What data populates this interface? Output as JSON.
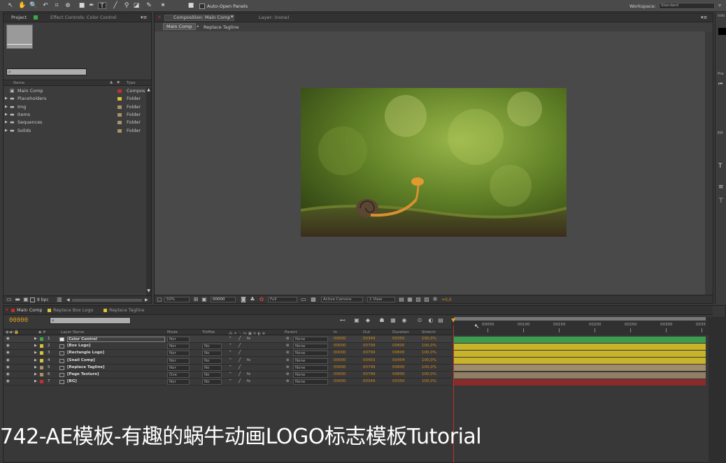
{
  "toolbar": {
    "auto_open_label": "Auto-Open Panels",
    "workspace_label": "Workspace:",
    "workspace_value": "Standard",
    "info_tab": "Info"
  },
  "project_panel": {
    "tabs": [
      {
        "label": "Project"
      },
      {
        "label": "Effect Controls: Color Control"
      }
    ],
    "search_placeholder": "",
    "col_name": "Name",
    "col_type": "Type",
    "items": [
      {
        "name": "Main Comp",
        "type": "Compos",
        "color": "#c03030"
      },
      {
        "name": "Placeholders",
        "type": "Folder",
        "color": "#d9c23a"
      },
      {
        "name": "Img",
        "type": "Folder",
        "color": "#a89268"
      },
      {
        "name": "Items",
        "type": "Folder",
        "color": "#a89268"
      },
      {
        "name": "Sequences",
        "type": "Folder",
        "color": "#a89268"
      },
      {
        "name": "Solids",
        "type": "Folder",
        "color": "#a89268"
      }
    ],
    "bpc": "8 bpc"
  },
  "comp_panel": {
    "tab": "Composition: Main Comp",
    "layer_tab": "Layer: (none)",
    "breadcrumbs": [
      "Main Comp",
      "Replace Tagline"
    ],
    "zoom": "50%",
    "timecode": "00000",
    "resolution": "Full",
    "camera": "Active Camera",
    "view": "1 View",
    "exposure": "+0,0"
  },
  "right_panel": {
    "preview_tab": "Pre",
    "effects_tab": "Eff",
    "paragraph_tab": "Par"
  },
  "timeline": {
    "tabs": [
      {
        "label": "Main Comp",
        "color": "#c03030"
      },
      {
        "label": "Replace Box Logo",
        "color": "#d9c23a"
      },
      {
        "label": "Replace Tagline",
        "color": "#d9c23a"
      }
    ],
    "timecode": "00000",
    "search_placeholder": "",
    "headers": {
      "layer_name": "Layer Name",
      "mode": "Mode",
      "trkmat": "TrkMat",
      "parent": "Parent",
      "in": "In",
      "out": "Out",
      "duration": "Duration",
      "stretch": "Stretch"
    },
    "ruler": [
      "00050",
      "00100",
      "00150",
      "00200",
      "00250",
      "00300",
      "0035"
    ],
    "layers": [
      {
        "num": "1",
        "name": "Color Control",
        "color": "#3fa84a",
        "mode": "Nor",
        "trk": "",
        "parent": "None",
        "in": "00000",
        "out": "00349",
        "dur": "00350",
        "stretch": "100,0%",
        "bar": "#3e9c50",
        "fx": "fx"
      },
      {
        "num": "2",
        "name": "[Box Logo]",
        "color": "#d9c23a",
        "mode": "Nor",
        "trk": "No",
        "parent": "None",
        "in": "00000",
        "out": "00799",
        "dur": "00800",
        "stretch": "100,0%",
        "bar": "#c8b42a",
        "fx": ""
      },
      {
        "num": "3",
        "name": "[Rectangle Logo]",
        "color": "#d9c23a",
        "mode": "Nor",
        "trk": "No",
        "parent": "None",
        "in": "00000",
        "out": "00799",
        "dur": "00800",
        "stretch": "100,0%",
        "bar": "#c8b42a",
        "fx": ""
      },
      {
        "num": "4",
        "name": "[Snail Comp]",
        "color": "#d9c23a",
        "mode": "Nor",
        "trk": "No",
        "parent": "None",
        "in": "00000",
        "out": "00403",
        "dur": "00404",
        "stretch": "100,0%",
        "bar": "#c8b42a",
        "fx": "fx"
      },
      {
        "num": "5",
        "name": "[Replace Tagline]",
        "color": "#a89268",
        "mode": "Nor",
        "trk": "No",
        "parent": "None",
        "in": "00000",
        "out": "00799",
        "dur": "00800",
        "stretch": "100,0%",
        "bar": "#a08c6a",
        "fx": ""
      },
      {
        "num": "6",
        "name": "[Page Texture]",
        "color": "#a89268",
        "mode": "Ove",
        "trk": "No",
        "parent": "None",
        "in": "00000",
        "out": "00799",
        "dur": "00800",
        "stretch": "100,0%",
        "bar": "#8f7f64",
        "fx": "fx"
      },
      {
        "num": "7",
        "name": "[BG]",
        "color": "#c03030",
        "mode": "Nor",
        "trk": "No",
        "parent": "None",
        "in": "00000",
        "out": "00349",
        "dur": "00350",
        "stretch": "100,0%",
        "bar": "#8a2a2a",
        "fx": "fx"
      }
    ]
  },
  "subtitle": "742-AE模板-有趣的蜗牛动画LOGO标志模板Tutorial"
}
